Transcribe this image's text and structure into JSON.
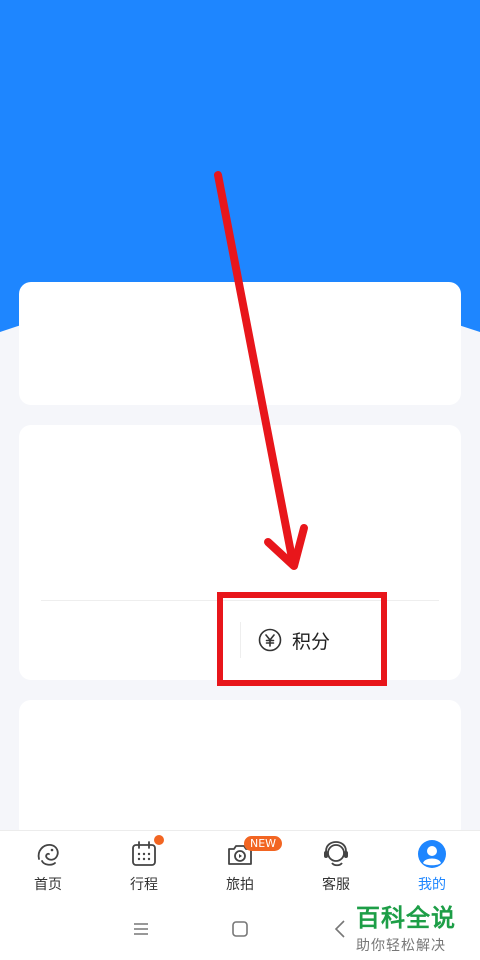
{
  "colors": {
    "header_blue": "#1e86ff",
    "annotation_red": "#e8161b",
    "badge_orange": "#f26522",
    "watermark_green": "#1d9e47"
  },
  "points_button": {
    "icon": "yen-coin-icon",
    "label": "积分"
  },
  "tabbar": {
    "tabs": [
      {
        "name": "home",
        "icon": "dolphin-icon",
        "label": "首页",
        "active": false
      },
      {
        "name": "itinerary",
        "icon": "calendar-icon",
        "label": "行程",
        "active": false,
        "dot": true
      },
      {
        "name": "travel-photo",
        "icon": "camera-icon",
        "label": "旅拍",
        "active": false,
        "badge": "NEW"
      },
      {
        "name": "service",
        "icon": "headset-icon",
        "label": "客服",
        "active": false
      },
      {
        "name": "mine",
        "icon": "user-icon",
        "label": "我的",
        "active": true
      }
    ]
  },
  "system_nav": [
    "menu-icon",
    "home-square-icon",
    "back-icon"
  ],
  "watermark": {
    "title": "百科全说",
    "subtitle": "助你轻松解决"
  }
}
